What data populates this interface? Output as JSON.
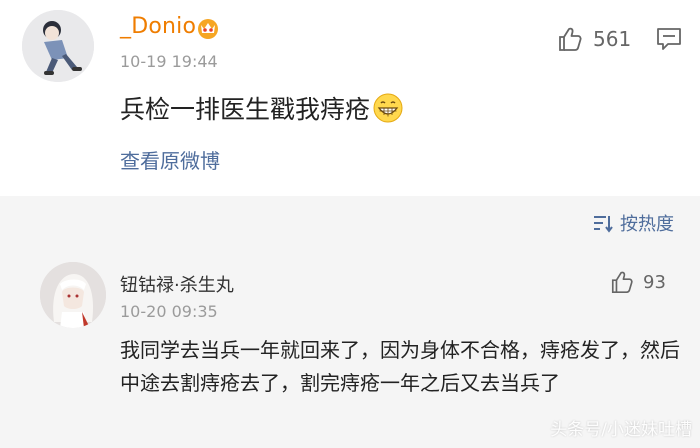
{
  "post": {
    "username": "_Donio",
    "time": "10-19 19:44",
    "like_count": "561",
    "text": "兵检一排医生戳我痔疮",
    "view_original": "查看原微博",
    "icons": {
      "vip": "vip-crown-icon",
      "like": "thumbs-up-icon",
      "comment": "comment-icon",
      "emoji": "grin-emoji-icon"
    }
  },
  "sort_bar": {
    "label": "按热度",
    "icon": "sort-icon"
  },
  "comment": {
    "username": "钮钴禄·杀生丸",
    "time": "10-20 09:35",
    "like_count": "93",
    "text": "我同学去当兵一年就回来了，因为身体不合格，痔疮发了，然后中途去割痔疮去了，割完痔疮一年之后又去当兵了"
  },
  "watermark": "头条号/小迷妹吐槽",
  "colors": {
    "username_orange": "#ef7d00",
    "link_blue": "#4f6d9c",
    "gray_text": "#9b9b9b",
    "comment_bg": "#f5f5f5"
  }
}
